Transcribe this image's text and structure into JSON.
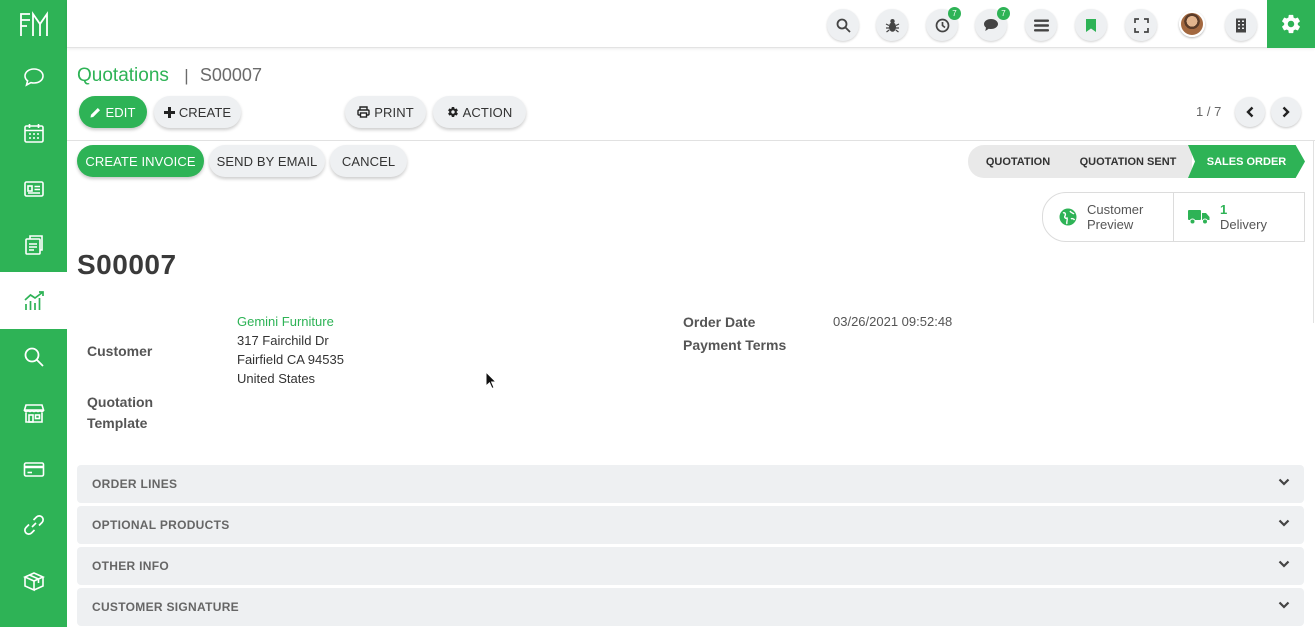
{
  "sidebar": {
    "logo_icon": "brand-logo-icon",
    "items": [
      {
        "icon": "chat-icon"
      },
      {
        "icon": "calendar-icon"
      },
      {
        "icon": "contacts-icon"
      },
      {
        "icon": "crm-icon"
      },
      {
        "icon": "sales-chart-icon",
        "active": true
      },
      {
        "icon": "search-icon"
      },
      {
        "icon": "store-icon"
      },
      {
        "icon": "card-icon"
      },
      {
        "icon": "link-icon"
      },
      {
        "icon": "gift-box-icon"
      }
    ]
  },
  "topbar": {
    "activity_badge": "7",
    "messages_badge": "7"
  },
  "breadcrumb": {
    "parent": "Quotations",
    "separator": "|",
    "current": "S00007"
  },
  "toolbar": {
    "edit_label": "EDIT",
    "create_label": "CREATE",
    "print_label": "PRINT",
    "action_label": "ACTION"
  },
  "pager": {
    "value": "1 / 7"
  },
  "header_buttons": {
    "create_invoice": "CREATE INVOICE",
    "send_by_email": "SEND BY EMAIL",
    "cancel": "CANCEL"
  },
  "status": {
    "stages": [
      "QUOTATION",
      "QUOTATION SENT",
      "SALES ORDER"
    ],
    "current": "SALES ORDER"
  },
  "smart_buttons": {
    "customer_preview_line1": "Customer",
    "customer_preview_line2": "Preview",
    "delivery_count": "1",
    "delivery_label": "Delivery"
  },
  "form": {
    "title": "S00007",
    "customer_label": "Customer",
    "customer_name": "Gemini Furniture",
    "address_line1": "317 Fairchild Dr",
    "address_line2": "Fairfield CA 94535",
    "address_line3": "United States",
    "template_label_line1": "Quotation",
    "template_label_line2": "Template",
    "order_date_label": "Order Date",
    "order_date_value": "03/26/2021 09:52:48",
    "payment_terms_label": "Payment Terms"
  },
  "sections": [
    {
      "title": "ORDER LINES"
    },
    {
      "title": "OPTIONAL PRODUCTS"
    },
    {
      "title": "OTHER INFO"
    },
    {
      "title": "CUSTOMER SIGNATURE"
    }
  ],
  "colors": {
    "brand": "#2eb356",
    "panel_grey": "#eef0f2"
  }
}
